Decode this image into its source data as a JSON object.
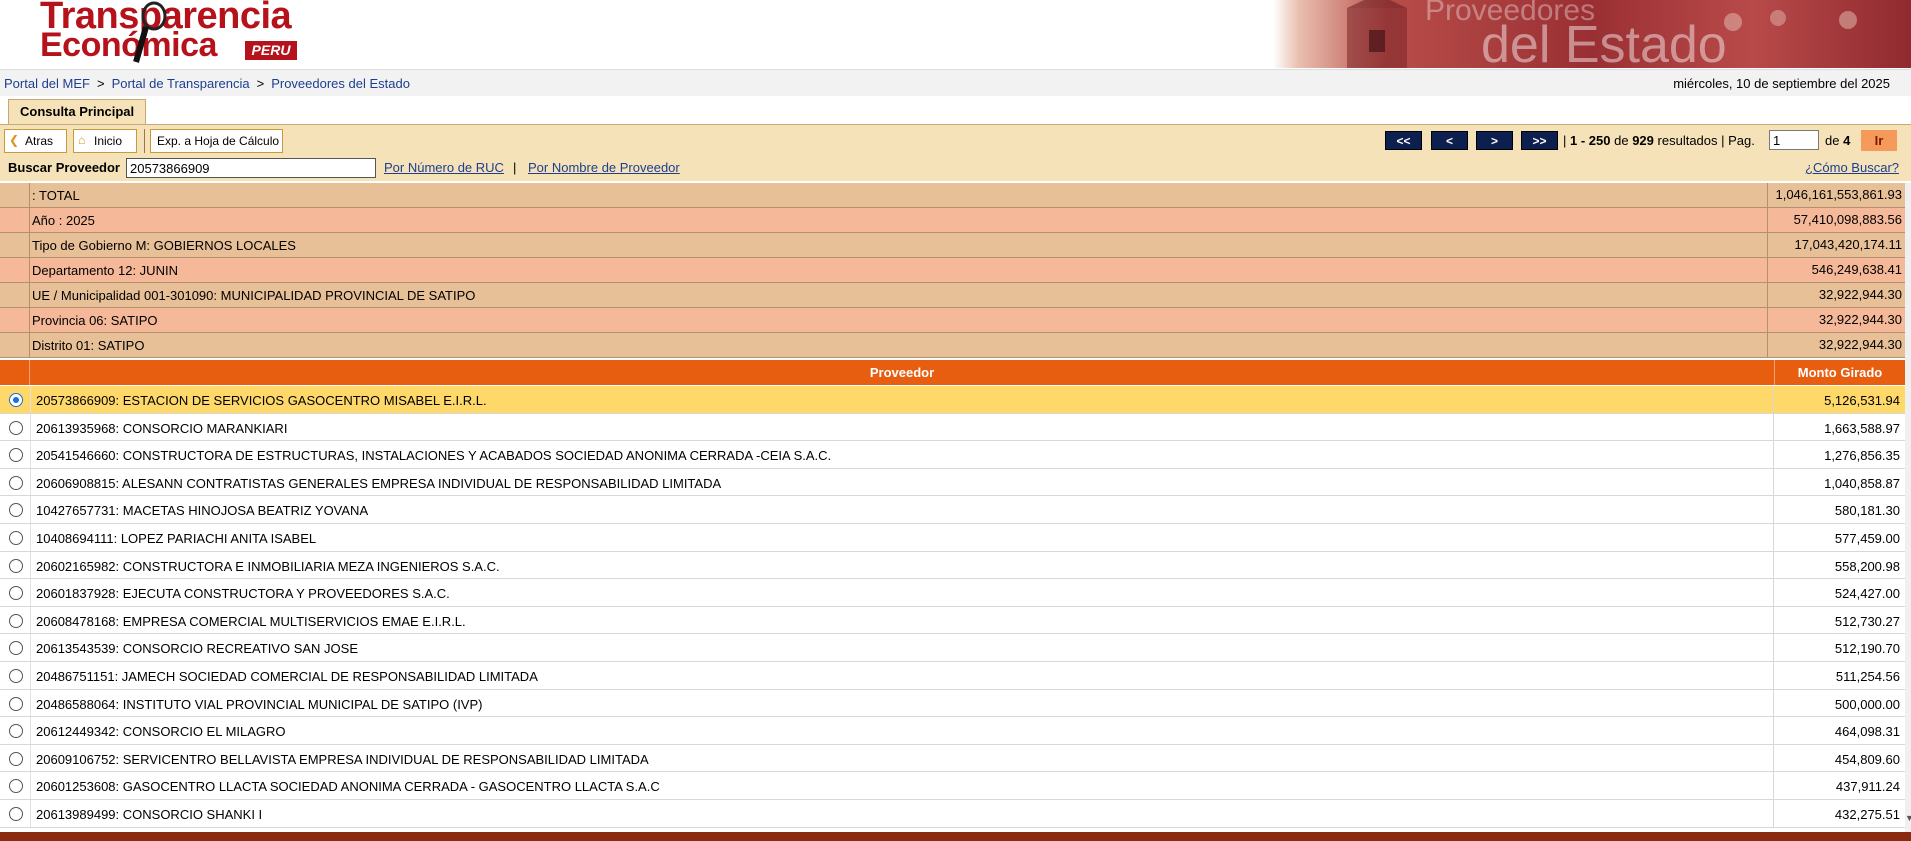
{
  "header": {
    "logo_line1": "Transparencia",
    "logo_line2": "Económica",
    "logo_badge": "PERU",
    "banner_line1": "Proveedores",
    "banner_line2": "del Estado"
  },
  "breadcrumb": {
    "items": [
      "Portal del MEF",
      "Portal de Transparencia",
      "Proveedores del Estado"
    ],
    "separator": ">"
  },
  "date": "miércoles, 10 de septiembre del 2025",
  "tab": {
    "label": "Consulta Principal"
  },
  "toolbar": {
    "back_label": "Atras",
    "home_label": "Inicio",
    "export_label": "Exp. a Hoja de Cálculo"
  },
  "pager": {
    "first": "<<",
    "prev": "<",
    "next": ">",
    "last": ">>",
    "range": "1 - 250",
    "de": "de",
    "total": "929",
    "resultados": "resultados",
    "pag_label": "Pag.",
    "page": "1",
    "de_pages": "de",
    "pages": "4",
    "go_label": "Ir"
  },
  "search": {
    "label": "Buscar Proveedor",
    "value": "20573866909",
    "by_ruc": "Por Número de RUC",
    "sep": "|",
    "by_name": "Por Nombre de Proveedor",
    "help": "¿Cómo Buscar?"
  },
  "summary": [
    {
      "label": ": TOTAL",
      "amount": "1,046,161,553,861.93"
    },
    {
      "label": "Año : 2025",
      "amount": "57,410,098,883.56"
    },
    {
      "label": "Tipo de Gobierno M: GOBIERNOS LOCALES",
      "amount": "17,043,420,174.11"
    },
    {
      "label": "Departamento 12: JUNIN",
      "amount": "546,249,638.41"
    },
    {
      "label": "UE / Municipalidad 001-301090: MUNICIPALIDAD PROVINCIAL DE SATIPO",
      "amount": "32,922,944.30"
    },
    {
      "label": "Provincia 06: SATIPO",
      "amount": "32,922,944.30"
    },
    {
      "label": "Distrito 01: SATIPO",
      "amount": "32,922,944.30"
    }
  ],
  "grid": {
    "col_proveedor": "Proveedor",
    "col_monto": "Monto Girado",
    "rows": [
      {
        "name": "20573866909: ESTACION DE SERVICIOS GASOCENTRO MISABEL E.I.R.L.",
        "amount": "5,126,531.94",
        "selected": true
      },
      {
        "name": "20613935968: CONSORCIO MARANKIARI",
        "amount": "1,663,588.97",
        "selected": false
      },
      {
        "name": "20541546660: CONSTRUCTORA DE ESTRUCTURAS, INSTALACIONES Y ACABADOS SOCIEDAD ANONIMA CERRADA -CEIA S.A.C.",
        "amount": "1,276,856.35",
        "selected": false
      },
      {
        "name": "20606908815: ALESANN CONTRATISTAS GENERALES EMPRESA INDIVIDUAL DE RESPONSABILIDAD LIMITADA",
        "amount": "1,040,858.87",
        "selected": false
      },
      {
        "name": "10427657731: MACETAS HINOJOSA BEATRIZ YOVANA",
        "amount": "580,181.30",
        "selected": false
      },
      {
        "name": "10408694111: LOPEZ PARIACHI ANITA ISABEL",
        "amount": "577,459.00",
        "selected": false
      },
      {
        "name": "20602165982: CONSTRUCTORA E INMOBILIARIA MEZA INGENIEROS S.A.C.",
        "amount": "558,200.98",
        "selected": false
      },
      {
        "name": "20601837928: EJECUTA CONSTRUCTORA Y PROVEEDORES S.A.C.",
        "amount": "524,427.00",
        "selected": false
      },
      {
        "name": "20608478168: EMPRESA COMERCIAL MULTISERVICIOS EMAE E.I.R.L.",
        "amount": "512,730.27",
        "selected": false
      },
      {
        "name": "20613543539: CONSORCIO RECREATIVO SAN JOSE",
        "amount": "512,190.70",
        "selected": false
      },
      {
        "name": "20486751151: JAMECH SOCIEDAD COMERCIAL DE RESPONSABILIDAD LIMITADA",
        "amount": "511,254.56",
        "selected": false
      },
      {
        "name": "20486588064: INSTITUTO VIAL PROVINCIAL MUNICIPAL DE SATIPO (IVP)",
        "amount": "500,000.00",
        "selected": false
      },
      {
        "name": "20612449342: CONSORCIO EL MILAGRO",
        "amount": "464,098.31",
        "selected": false
      },
      {
        "name": "20609106752: SERVICENTRO BELLAVISTA EMPRESA INDIVIDUAL DE RESPONSABILIDAD LIMITADA",
        "amount": "454,809.60",
        "selected": false
      },
      {
        "name": "20601253608: GASOCENTRO LLACTA SOCIEDAD ANONIMA CERRADA - GASOCENTRO LLACTA S.A.C",
        "amount": "437,911.24",
        "selected": false
      },
      {
        "name": "20613989499: CONSORCIO SHANKI I",
        "amount": "432,275.51",
        "selected": false
      }
    ]
  },
  "colors": {
    "brand_red": "#b5121b",
    "toolbar_bg": "#f5e2b8",
    "grid_header": "#e85e10",
    "selected_row": "#ffd86a",
    "link": "#1d3f8f"
  }
}
